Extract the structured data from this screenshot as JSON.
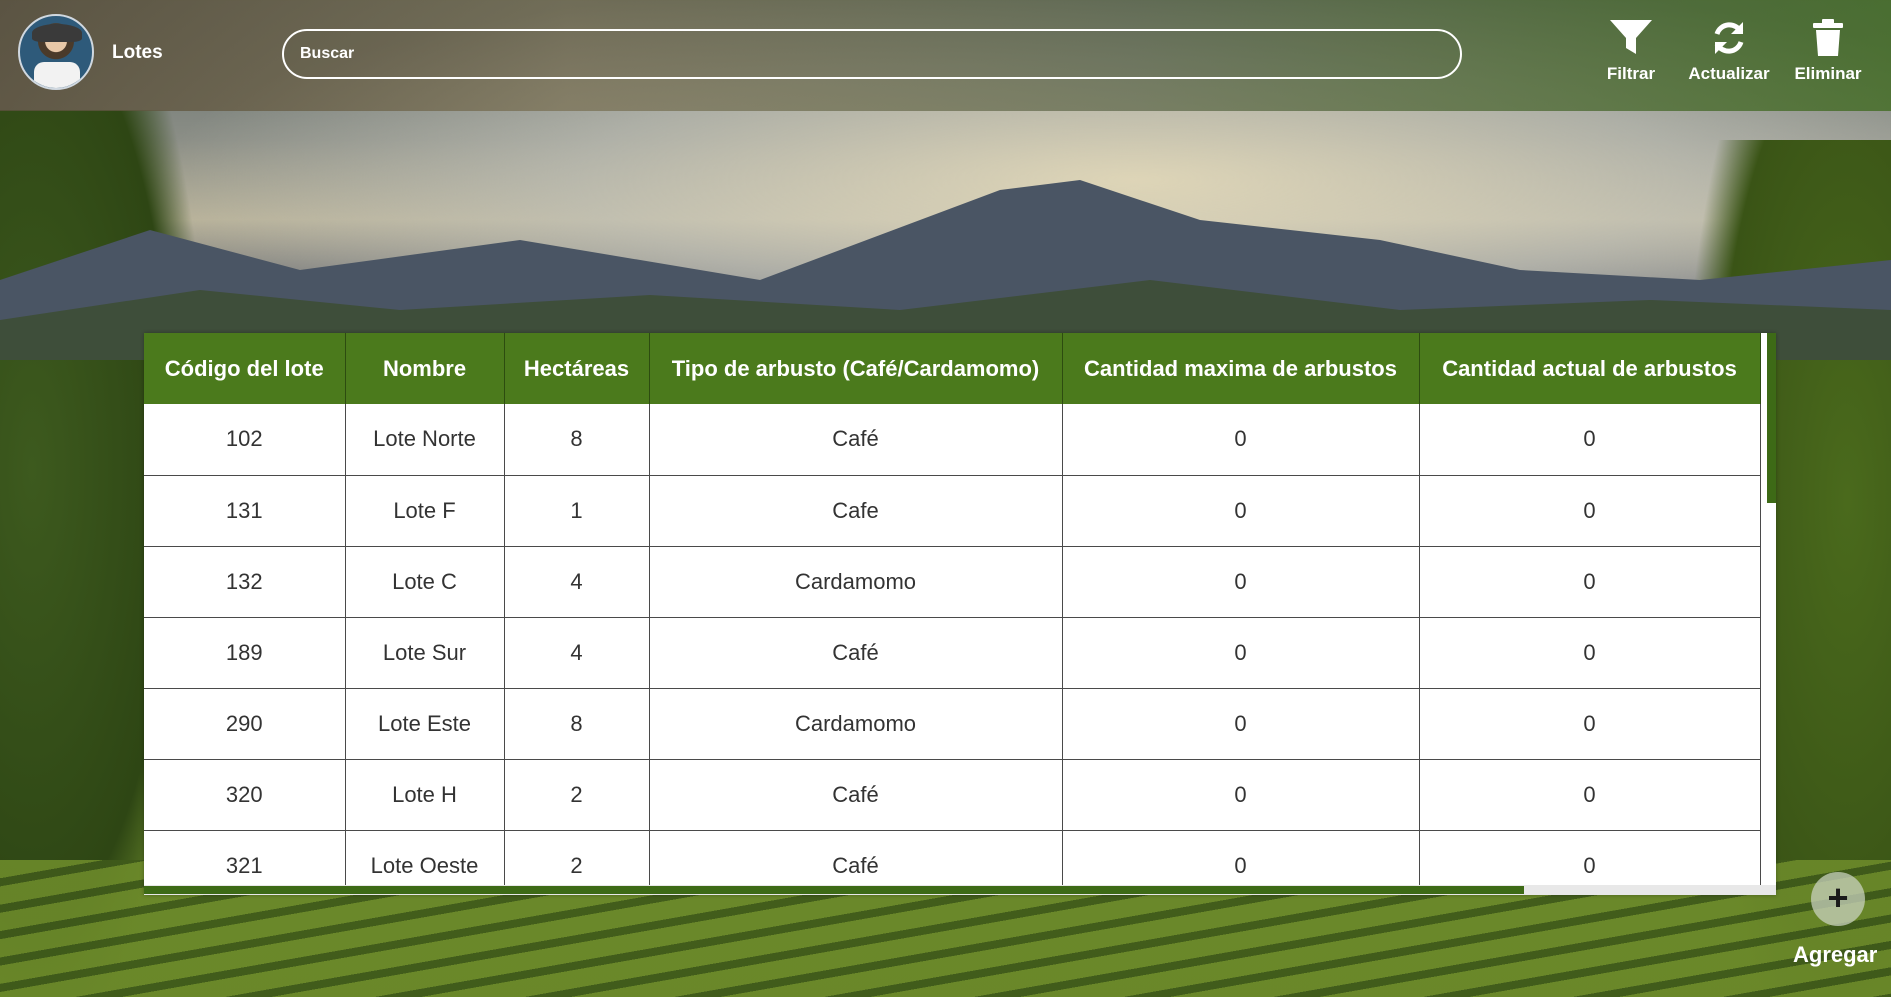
{
  "header": {
    "title": "Lotes",
    "search_placeholder": "Buscar",
    "actions": [
      {
        "label": "Filtrar",
        "icon": "filter-icon"
      },
      {
        "label": "Actualizar",
        "icon": "refresh-icon"
      },
      {
        "label": "Eliminar",
        "icon": "trash-icon"
      }
    ]
  },
  "table": {
    "columns": [
      "Código del lote",
      "Nombre",
      "Hectáreas",
      "Tipo de arbusto (Café/Cardamomo)",
      "Cantidad maxima de arbustos",
      "Cantidad actual de arbustos"
    ],
    "rows": [
      [
        "102",
        "Lote Norte",
        "8",
        "Café",
        "0",
        "0"
      ],
      [
        "131",
        "Lote F",
        "1",
        "Cafe",
        "0",
        "0"
      ],
      [
        "132",
        "Lote C",
        "4",
        "Cardamomo",
        "0",
        "0"
      ],
      [
        "189",
        "Lote Sur",
        "4",
        "Café",
        "0",
        "0"
      ],
      [
        "290",
        "Lote Este",
        "8",
        "Cardamomo",
        "0",
        "0"
      ],
      [
        "320",
        "Lote H",
        "2",
        "Café",
        "0",
        "0"
      ],
      [
        "321",
        "Lote Oeste",
        "2",
        "Café",
        "0",
        "0"
      ]
    ]
  },
  "add": {
    "symbol": "+",
    "label": "Agregar",
    "icon": "plus-icon"
  },
  "colors": {
    "header_green": "#4b7a1c",
    "scroll_thumb": "#3d6a16",
    "text_light": "#ffffff"
  }
}
